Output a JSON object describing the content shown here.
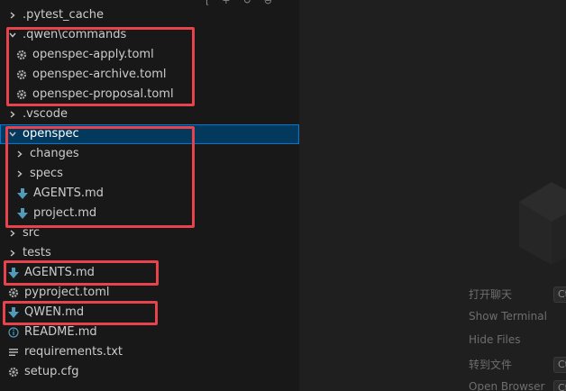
{
  "toolbar_glyphs": [
    "[",
    "+",
    "↻",
    "⊖"
  ],
  "tree": [
    {
      "label": ".pytest_cache",
      "kind": "folder",
      "expanded": false,
      "icon": "chevron-right"
    },
    {
      "label": ".qwen\\commands",
      "kind": "folder",
      "expanded": true,
      "icon": "chevron-down"
    },
    {
      "label": "openspec-apply.toml",
      "kind": "file",
      "icon": "gear-icon"
    },
    {
      "label": "openspec-archive.toml",
      "kind": "file",
      "icon": "gear-icon"
    },
    {
      "label": "openspec-proposal.toml",
      "kind": "file",
      "icon": "gear-icon"
    },
    {
      "label": ".vscode",
      "kind": "folder",
      "expanded": false,
      "icon": "chevron-right"
    },
    {
      "label": "openspec",
      "kind": "folder",
      "expanded": true,
      "selected": true,
      "icon": "chevron-down"
    },
    {
      "label": "changes",
      "kind": "folder",
      "expanded": false,
      "icon": "chevron-right"
    },
    {
      "label": "specs",
      "kind": "folder",
      "expanded": false,
      "icon": "chevron-right"
    },
    {
      "label": "AGENTS.md",
      "kind": "file",
      "icon": "markdown-arrow-icon"
    },
    {
      "label": "project.md",
      "kind": "file",
      "icon": "markdown-arrow-icon"
    },
    {
      "label": "src",
      "kind": "folder",
      "expanded": false,
      "icon": "chevron-right"
    },
    {
      "label": "tests",
      "kind": "folder",
      "expanded": false,
      "icon": "chevron-right"
    },
    {
      "label": "AGENTS.md",
      "kind": "file",
      "icon": "markdown-arrow-icon"
    },
    {
      "label": "pyproject.toml",
      "kind": "file",
      "icon": "gear-icon"
    },
    {
      "label": "QWEN.md",
      "kind": "file",
      "icon": "markdown-arrow-icon"
    },
    {
      "label": "README.md",
      "kind": "file",
      "icon": "info-icon"
    },
    {
      "label": "requirements.txt",
      "kind": "file",
      "icon": "lines-icon"
    },
    {
      "label": "setup.cfg",
      "kind": "file",
      "icon": "gear-icon"
    }
  ],
  "editor_hints": [
    {
      "label": "打开聊天",
      "key": "Ctrl"
    },
    {
      "label": "Show Terminal",
      "key": ""
    },
    {
      "label": "Hide Files",
      "key": ""
    },
    {
      "label": "转到文件",
      "key": "Ctrl"
    },
    {
      "label": "Open Browser",
      "key": "Ctrl"
    }
  ],
  "colors": {
    "highlight": "#e8434d",
    "selection": "#04395e",
    "focus_border": "#0078d4",
    "markdown_icon": "#519aba",
    "info_icon": "#519aba",
    "gear_icon": "#a9a9a9"
  }
}
